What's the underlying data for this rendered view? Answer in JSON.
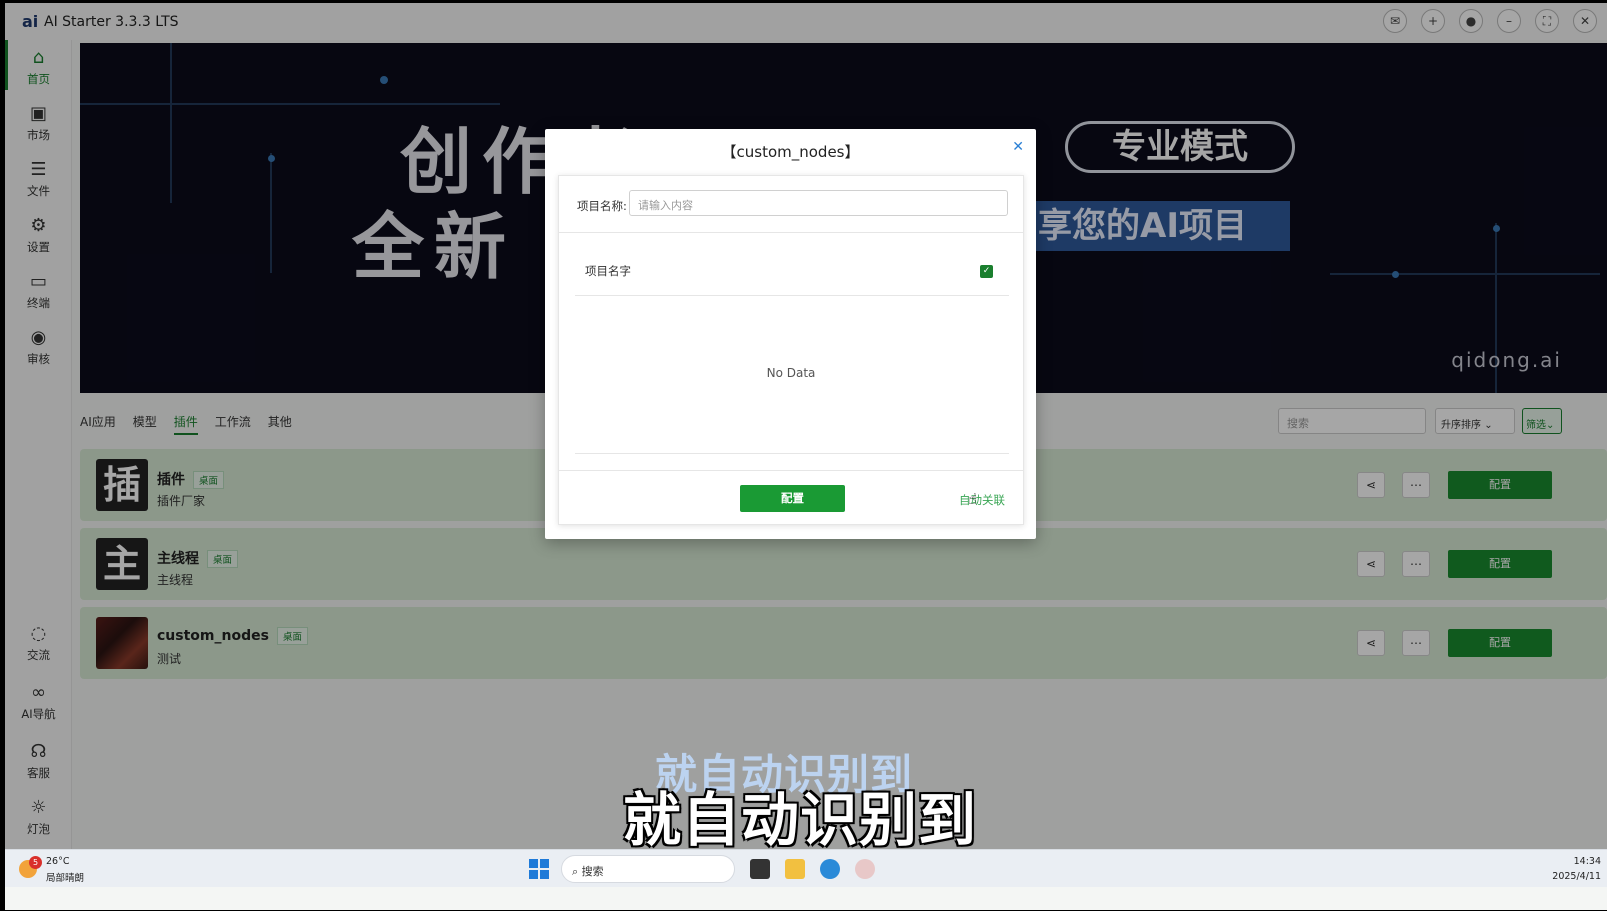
{
  "window": {
    "title": "AI Starter 3.3.3 LTS",
    "logo": "ai"
  },
  "sidebar": {
    "top_items": [
      {
        "label": "首页",
        "icon": "home-icon"
      },
      {
        "label": "市场",
        "icon": "shopping-bag-icon"
      },
      {
        "label": "文件",
        "icon": "file-stack-icon"
      },
      {
        "label": "设置",
        "icon": "gear-icon"
      },
      {
        "label": "终端",
        "icon": "terminal-icon"
      },
      {
        "label": "审核",
        "icon": "eye-icon"
      }
    ],
    "bottom_items": [
      {
        "label": "交流",
        "icon": "chat-bubble-icon"
      },
      {
        "label": "AI导航",
        "icon": "link-icon"
      },
      {
        "label": "客服",
        "icon": "headset-icon"
      },
      {
        "label": "灯泡",
        "icon": "sun-icon"
      }
    ]
  },
  "banner": {
    "line1": "创作者",
    "line2": "全新",
    "pill1": "专业模式",
    "pill2": "享您的AI项目",
    "brand": "qidong.ai"
  },
  "tabs": [
    "AI应用",
    "模型",
    "插件",
    "工作流",
    "其他"
  ],
  "active_tab": "插件",
  "toolbar": {
    "search_placeholder": "搜索",
    "sort_label": "升序排序",
    "filter_label": "筛选"
  },
  "items": [
    {
      "thumb": "插",
      "name": "插件",
      "tag": "桌面",
      "desc": "插件厂家",
      "button": "配置"
    },
    {
      "thumb": "主",
      "name": "主线程",
      "tag": "桌面",
      "desc": "主线程",
      "button": "配置"
    },
    {
      "thumb": "",
      "name": "custom_nodes",
      "tag": "桌面",
      "desc": "测试",
      "button": "配置"
    }
  ],
  "dialog": {
    "title": "【custom_nodes】",
    "field_label": "项目名称:",
    "field_placeholder": "请输入内容",
    "column_label": "项目名字",
    "empty_text": "No Data",
    "confirm_button": "配置",
    "link_text": "自动关联"
  },
  "subtitle": {
    "ghost": "就自动识别到",
    "main": "就自动识别到"
  },
  "taskbar": {
    "weather_temp": "26°C",
    "weather_desc": "局部晴朗",
    "weather_badge": "5",
    "search_label": "搜索",
    "time": "14:34",
    "date": "2025/4/11"
  },
  "colors": {
    "accent": "#1a7f2e",
    "banner_bg": "#0b0b1b",
    "row_bg": "#d7ead5"
  }
}
